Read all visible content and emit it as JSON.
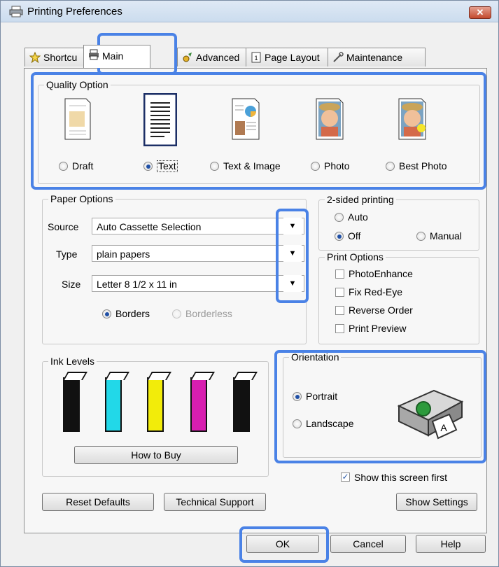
{
  "window": {
    "title": "Printing Preferences",
    "close_glyph": "✕"
  },
  "tabs": [
    {
      "label": "Shortcu",
      "icon": "star-icon"
    },
    {
      "label": "Main",
      "icon": "printer-icon"
    },
    {
      "label": "Advanced",
      "icon": "advanced-icon"
    },
    {
      "label": "Page Layout",
      "icon": "page-layout-icon"
    },
    {
      "label": "Maintenance",
      "icon": "wrench-icon"
    }
  ],
  "quality": {
    "label": "Quality Option",
    "options": [
      "Draft",
      "Text",
      "Text & Image",
      "Photo",
      "Best Photo"
    ],
    "selected": "Text"
  },
  "paper": {
    "label": "Paper Options",
    "source_label": "Source",
    "source_value": "Auto Cassette Selection",
    "type_label": "Type",
    "type_value": "plain papers",
    "size_label": "Size",
    "size_value": "Letter 8 1/2 x 11 in",
    "borders": "Borders",
    "borderless": "Borderless"
  },
  "two_sided": {
    "label": "2-sided printing",
    "auto": "Auto",
    "off": "Off",
    "manual": "Manual",
    "selected": "Off"
  },
  "print_options": {
    "label": "Print Options",
    "items": [
      "PhotoEnhance",
      "Fix Red-Eye",
      "Reverse Order",
      "Print Preview"
    ]
  },
  "ink": {
    "label": "Ink Levels",
    "colors": [
      "#111111",
      "#22d8e8",
      "#f2ec0a",
      "#d81eb0",
      "#111111"
    ],
    "how_to_buy": "How to Buy"
  },
  "orientation": {
    "label": "Orientation",
    "portrait": "Portrait",
    "landscape": "Landscape",
    "selected": "Portrait"
  },
  "show_first": {
    "label": "Show this screen first",
    "checked": true,
    "check_glyph": "✓"
  },
  "buttons": {
    "reset": "Reset Defaults",
    "support": "Technical Support",
    "show_settings": "Show Settings",
    "ok": "OK",
    "cancel": "Cancel",
    "help": "Help"
  },
  "highlight_color": "#4a82e6"
}
